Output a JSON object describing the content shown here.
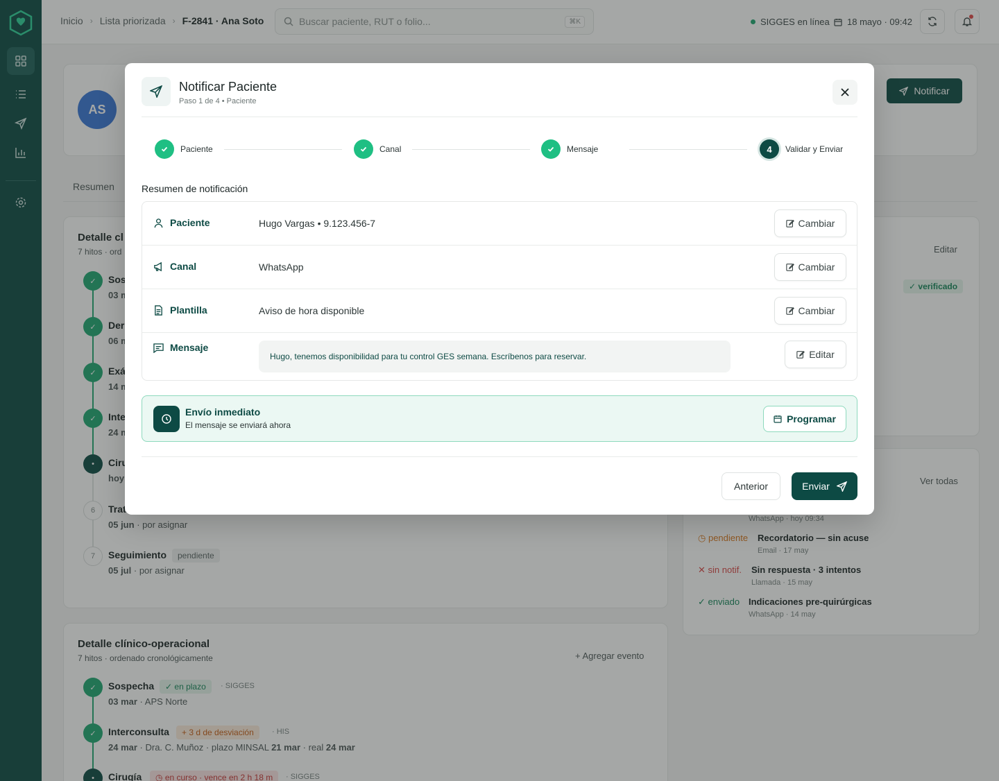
{
  "topbar": {
    "breadcrumbs": [
      "Inicio",
      "Lista priorizada",
      "F-2841 · Ana Soto"
    ],
    "search_placeholder": "Buscar paciente, RUT o folio...",
    "search_shortcut": "⌘K",
    "status": "SIGGES en línea",
    "date": "18 mayo · 09:42"
  },
  "patient_header": {
    "initials": "AS",
    "notify_label": "Notificar",
    "tab_summary": "Resumen"
  },
  "timeline_card_top": {
    "title_partial": "Detalle cl",
    "subtitle_partial": "7 hitos · ord",
    "items": [
      {
        "name": "Sos",
        "date": "03 m"
      },
      {
        "name": "Der",
        "date": "06 m"
      },
      {
        "name": "Exá",
        "date": "14 m"
      },
      {
        "name": "Inte",
        "date": "24 m"
      },
      {
        "name": "Ciru",
        "date": "hoy"
      },
      {
        "num": "6",
        "name": "Trat",
        "date": "05 jun",
        "meta": "· por asignar"
      },
      {
        "num": "7",
        "name": "Seguimiento",
        "badge": "pendiente",
        "date": "05 jul",
        "meta": "· por asignar"
      }
    ]
  },
  "right_card_top": {
    "edit": "Editar",
    "badge": "verificado"
  },
  "comms_card": {
    "view_all": "Ver todas",
    "items": [
      {
        "status": "",
        "title": "",
        "meta": "WhatsApp · hoy 09:34"
      },
      {
        "status": "pendiente",
        "title": "Recordatorio — sin acuse",
        "meta": "Email · 17 may"
      },
      {
        "status": "sin notif.",
        "title": "Sin respuesta · 3 intentos",
        "meta": "Llamada · 15 may"
      },
      {
        "status": "enviado",
        "title": "Indicaciones pre-quirúrgicas",
        "meta": "WhatsApp · 14 may"
      }
    ]
  },
  "timeline_card_bottom": {
    "title": "Detalle clínico-operacional",
    "subtitle": "7 hitos · ordenado cronológicamente",
    "add_event": "Agregar evento",
    "items": [
      {
        "name": "Sospecha",
        "badge": "en plazo",
        "source": "· SIGGES",
        "date": "03 mar",
        "meta": "· APS Norte"
      },
      {
        "name": "Interconsulta",
        "badge": "+ 3  d de desviación",
        "source": "· HIS",
        "date": "24 mar",
        "meta_a": "· Dra. C. Muñoz · plazo MINSAL",
        "meta_b": "21 mar",
        "meta_c": "· real",
        "meta_d": "24 mar"
      },
      {
        "name": "Cirugía",
        "badge": "en curso · vence en 2 h 18 m",
        "source": "· SIGGES"
      }
    ]
  },
  "modal": {
    "title": "Notificar Paciente",
    "subtitle": "Paso 1 de 4 • Paciente",
    "steps": [
      {
        "label": "Paciente",
        "state": "done"
      },
      {
        "label": "Canal",
        "state": "done"
      },
      {
        "label": "Mensaje",
        "state": "done"
      },
      {
        "label": "Validar y Enviar",
        "state": "current",
        "num": "4"
      }
    ],
    "summary_title": "Resumen de notificación",
    "rows": {
      "patient": {
        "label": "Paciente",
        "value": "Hugo Vargas • 9.123.456-7",
        "action": "Cambiar"
      },
      "channel": {
        "label": "Canal",
        "value": "WhatsApp",
        "action": "Cambiar"
      },
      "template": {
        "label": "Plantilla",
        "value": "Aviso de hora disponible",
        "action": "Cambiar"
      },
      "message": {
        "label": "Mensaje",
        "value": "Hugo, tenemos disponibilidad para tu control GES semana. Escríbenos para reservar.",
        "action": "Editar"
      }
    },
    "send_now": {
      "title": "Envío inmediato",
      "desc": "El mensaje se enviará ahora",
      "schedule": "Programar"
    },
    "footer": {
      "prev": "Anterior",
      "send": "Enviar"
    }
  },
  "colors": {
    "brand": "#0d4a44",
    "success": "#1fbf83",
    "accent_light": "#ebf8f3"
  }
}
